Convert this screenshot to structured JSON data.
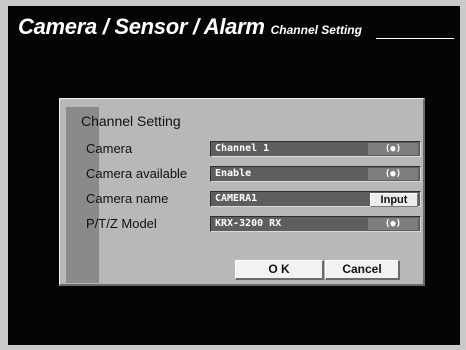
{
  "header": {
    "title": "Camera / Sensor / Alarm",
    "subtitle": "Channel Setting"
  },
  "dialog": {
    "title": "Channel Setting",
    "rows": [
      {
        "label": "Camera",
        "value": "Channel 1",
        "control": "(●)"
      },
      {
        "label": "Camera available",
        "value": "Enable",
        "control": "(●)"
      },
      {
        "label": "Camera name",
        "value": "CAMERA1",
        "control": "Input"
      },
      {
        "label": "P/T/Z Model",
        "value": "KRX-3200 RX",
        "control": "(●)"
      }
    ],
    "ok_label": "O K",
    "cancel_label": "Cancel"
  }
}
